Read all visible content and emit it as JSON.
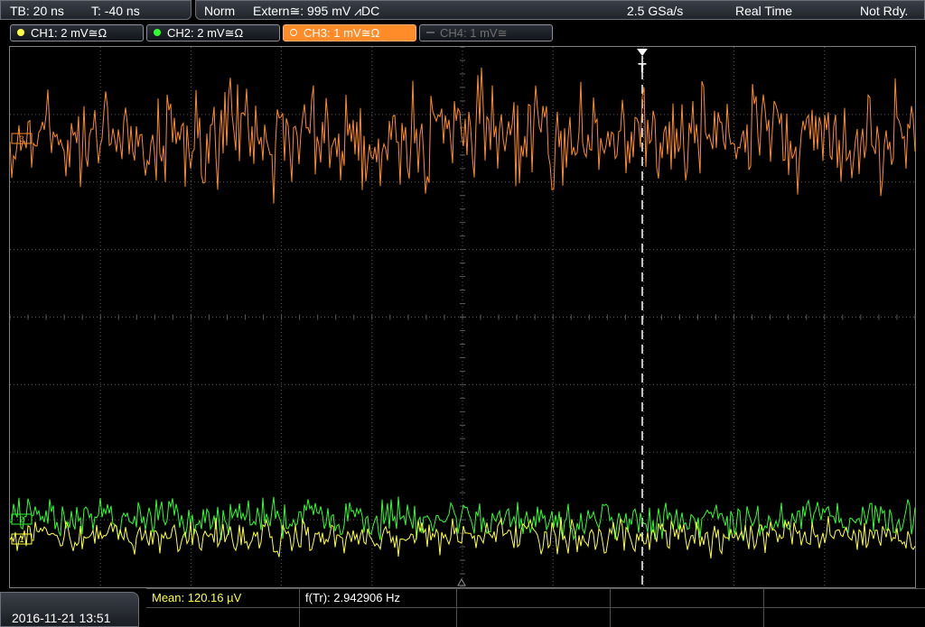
{
  "status_bar": {
    "timebase": "TB: 20 ns",
    "trigger_time": "T: -40 ns",
    "mode": "Norm",
    "trigger_source": "Extern≅: 995 mV ⩘DC",
    "sample_rate": "2.5 GSa/s",
    "acquisition": "Real Time",
    "status": "Not Rdy."
  },
  "channels": [
    {
      "label": "CH1: 2 mV≅Ω",
      "color": "#ffff40",
      "active": true
    },
    {
      "label": "CH2: 2 mV≅Ω",
      "color": "#30ff30",
      "active": true
    },
    {
      "label": "CH3: 1 mV≅Ω",
      "color": "#ff8c28",
      "active": true,
      "selected": true
    },
    {
      "label": "CH4: 1 mV≅",
      "color": "#707070",
      "active": false
    }
  ],
  "trigger_marker": "T",
  "channel_markers": {
    "ch1": "1",
    "ch2": "2",
    "ch3": "3"
  },
  "colors": {
    "ch1": "#ffff40",
    "ch2": "#30ff30",
    "ch3": "#ff8c28",
    "grid": "#5a5a5a",
    "mean_text": "#ffff40"
  },
  "measurements": {
    "mean": "Mean: 120.16 µV",
    "frequency": "f(Tr): 2.942906 Hz"
  },
  "datetime": "2016-11-21 13:51"
}
